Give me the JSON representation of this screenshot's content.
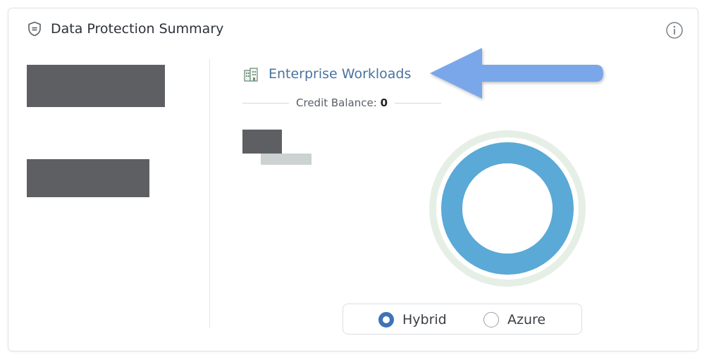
{
  "header": {
    "title": "Data Protection Summary",
    "icon": "shield-icon",
    "info_icon": "info-icon"
  },
  "workloads": {
    "link_label": "Enterprise Workloads",
    "icon": "building-icon",
    "credit_label": "Credit Balance:",
    "credit_value": "0"
  },
  "toggle": {
    "options": [
      {
        "label": "Hybrid",
        "selected": true
      },
      {
        "label": "Azure",
        "selected": false
      }
    ]
  },
  "colors": {
    "accent": "#3e73b6",
    "link": "#4a72a0",
    "donut_fill": "#5aa9d6",
    "donut_outer": "#e6efe6",
    "arrow": "#7aa7ea",
    "redaction": "#5e5f63"
  }
}
